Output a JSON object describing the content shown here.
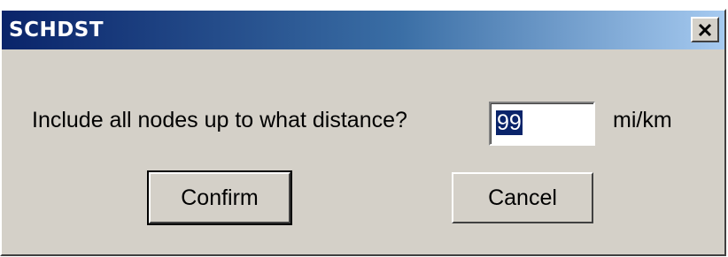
{
  "window": {
    "title": "SCHDST",
    "close_icon": "close-x-icon"
  },
  "form": {
    "prompt": "Include all nodes up to what distance?",
    "distance_value": "99",
    "unit_label": "mi/km"
  },
  "buttons": {
    "confirm_label": "Confirm",
    "cancel_label": "Cancel"
  },
  "colors": {
    "titlebar_start": "#0a246a",
    "titlebar_end": "#a6caf0",
    "dialog_bg": "#d4d0c8",
    "selection": "#0a246a"
  }
}
